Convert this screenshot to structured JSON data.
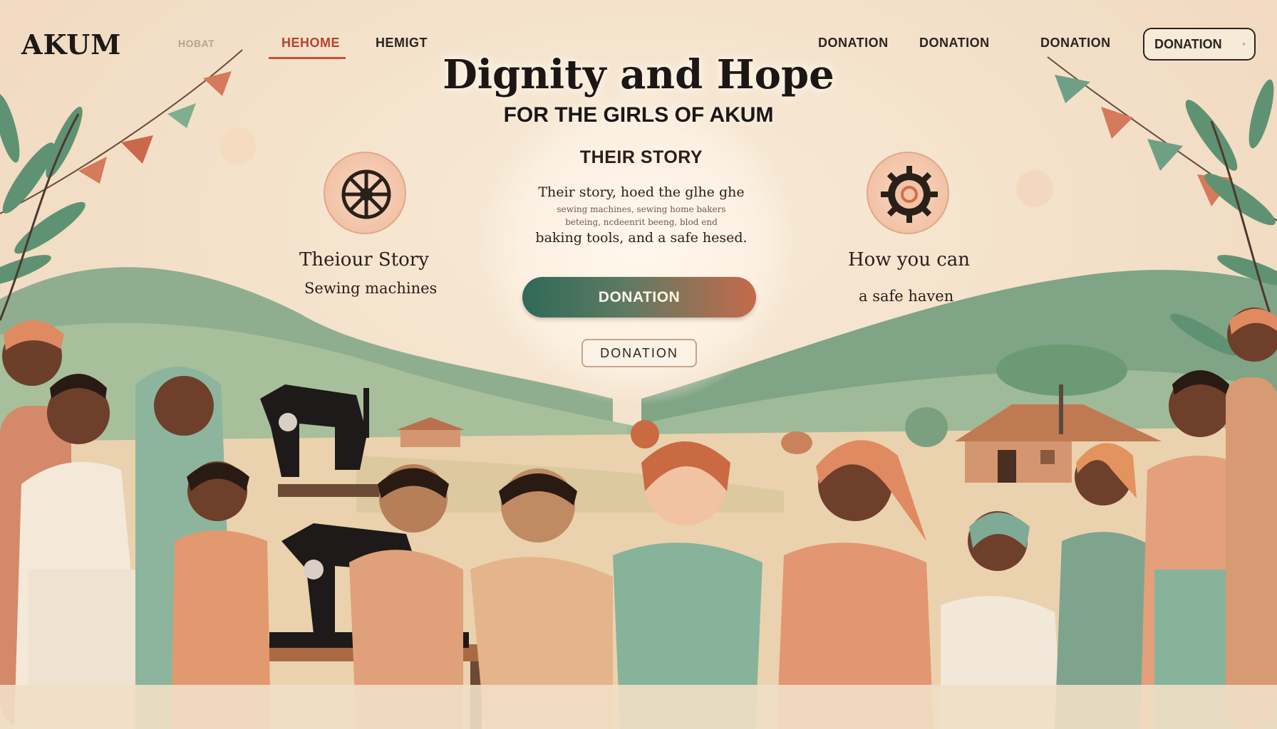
{
  "header": {
    "logo": "AKUM",
    "nav": [
      {
        "label": "HOBAT"
      },
      {
        "label": "HEHOME"
      },
      {
        "label": "HEMIGT"
      },
      {
        "label": "DONATION"
      },
      {
        "label": "DONATION"
      },
      {
        "label": "DONATION"
      }
    ],
    "cta_label": "DONATION"
  },
  "hero": {
    "title": "Dignity and Hope",
    "subtitle": "FOR THE GIRLS OF AKUM"
  },
  "story_card": {
    "heading": "THEIR STORY",
    "line1": "Their story, hoed the glhe ghe",
    "line2": "sewing machines, sewing home bakers",
    "line3": "beteing, ncdeenrit beeng, blod end",
    "line4": "baking tools, and a safe hesed.",
    "primary_button": "DONATION",
    "secondary_button": "DONATION"
  },
  "features": {
    "left": {
      "icon": "sewing-wheel-icon",
      "title": "Theiour Story",
      "desc": "Sewing machines"
    },
    "right": {
      "icon": "gear-icon",
      "title": "How you can",
      "desc": "a safe haven"
    }
  },
  "colors": {
    "accent_green": "#2f6a58",
    "accent_terracotta": "#c56a4a",
    "background": "#f1dcc4"
  }
}
